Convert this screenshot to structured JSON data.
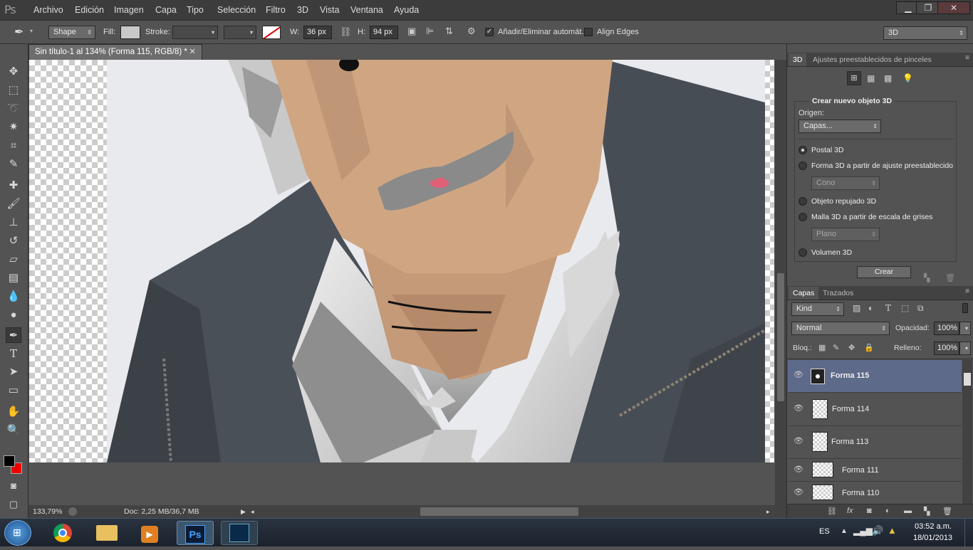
{
  "menubar": {
    "logo": "Ps",
    "items": [
      "Archivo",
      "Edición",
      "Imagen",
      "Capa",
      "Tipo",
      "Selección",
      "Filtro",
      "3D",
      "Vista",
      "Ventana",
      "Ayuda"
    ],
    "min": "▁",
    "max": "❐",
    "close": "✕"
  },
  "options": {
    "mode": "Shape",
    "fill_label": "Fill:",
    "stroke_label": "Stroke:",
    "w_label": "W:",
    "w_value": "36 px",
    "h_label": "H:",
    "h_value": "94 px",
    "add_remove_label": "Añadir/Eliminar automát.",
    "align_edges_label": "Align Edges",
    "workspace": "3D",
    "chk_add_remove": true,
    "chk_align": false
  },
  "document": {
    "tab_title": "Sin título-1 al 134% (Forma 115, RGB/8) *",
    "close": "✕"
  },
  "status": {
    "zoom": "133,79%",
    "doc": "Doc: 2,25 MB/36,7 MB"
  },
  "panel3d": {
    "tabs": [
      "3D",
      "Ajustes preestablecidos de pinceles"
    ],
    "section_title": "Crear nuevo objeto 3D",
    "origin_label": "Origen:",
    "origin_value": "Capas...",
    "options": [
      "Postal 3D",
      "Forma 3D a partir de ajuste preestablecido",
      "Objeto repujado 3D",
      "Malla 3D a partir de escala de grises",
      "Volumen 3D"
    ],
    "preset_value": "Cono",
    "grayscale_value": "Plano",
    "create_button": "Crear"
  },
  "layers": {
    "tabs": [
      "Capas",
      "Trazados"
    ],
    "kind": "Kind",
    "blend": "Normal",
    "opacity_label": "Opacidad:",
    "opacity_value": "100%",
    "lock_label": "Bloq.:",
    "fill_label": "Relleno:",
    "fill_value": "100%",
    "items": [
      "Forma 115",
      "Forma 114",
      "Forma 113",
      "Forma 111",
      "Forma 110"
    ],
    "selected": "Forma 115"
  },
  "taskbar": {
    "lang": "ES",
    "time": "03:52 a.m.",
    "date": "18/01/2013"
  }
}
